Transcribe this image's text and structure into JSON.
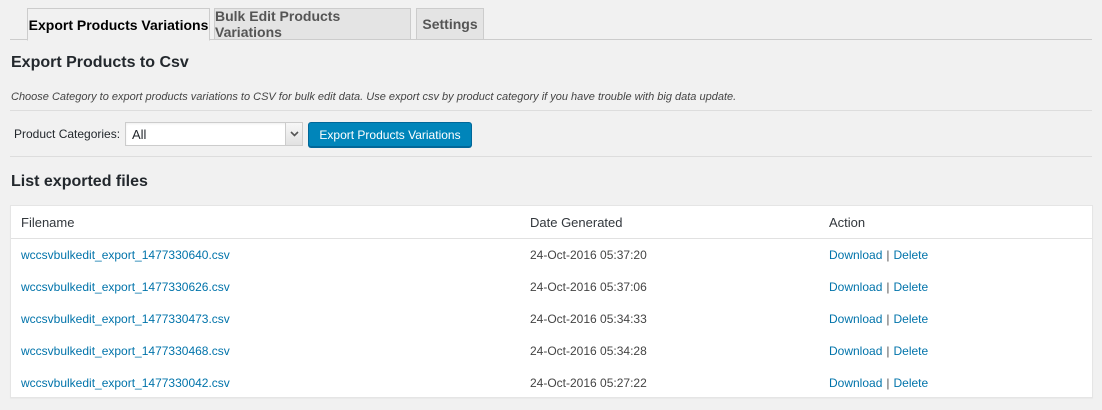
{
  "tabs": [
    {
      "label": "Export Products Variations",
      "active": true
    },
    {
      "label": "Bulk Edit Products Variations",
      "active": false
    },
    {
      "label": "Settings",
      "active": false
    }
  ],
  "export": {
    "title": "Export Products to Csv",
    "description": "Choose Category to export products variations to CSV for bulk edit data. Use export csv by product category if you have trouble with big data update.",
    "category_label": "Product Categories:",
    "category_value": "All",
    "button_label": "Export Products Variations"
  },
  "files": {
    "title": "List exported files",
    "columns": {
      "filename": "Filename",
      "date": "Date Generated",
      "action": "Action"
    },
    "rows": [
      {
        "filename": "wccsvbulkedit_export_1477330640.csv",
        "date": "24-Oct-2016 05:37:20",
        "download": "Download",
        "sep": "|",
        "delete": "Delete"
      },
      {
        "filename": "wccsvbulkedit_export_1477330626.csv",
        "date": "24-Oct-2016 05:37:06",
        "download": "Download",
        "sep": "|",
        "delete": "Delete"
      },
      {
        "filename": "wccsvbulkedit_export_1477330473.csv",
        "date": "24-Oct-2016 05:34:33",
        "download": "Download",
        "sep": "|",
        "delete": "Delete"
      },
      {
        "filename": "wccsvbulkedit_export_1477330468.csv",
        "date": "24-Oct-2016 05:34:28",
        "download": "Download",
        "sep": "|",
        "delete": "Delete"
      },
      {
        "filename": "wccsvbulkedit_export_1477330042.csv",
        "date": "24-Oct-2016 05:27:22",
        "download": "Download",
        "sep": "|",
        "delete": "Delete"
      }
    ]
  },
  "colors": {
    "link": "#0073aa",
    "primary_button": "#0085ba",
    "background": "#f1f1f1"
  }
}
